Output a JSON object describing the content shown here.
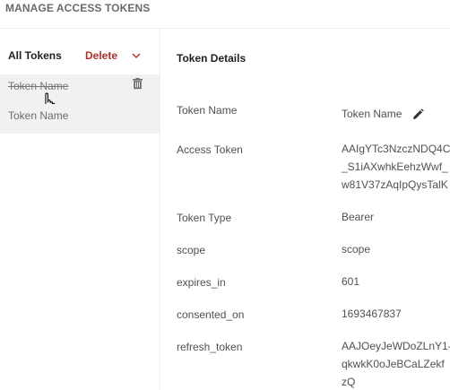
{
  "header": {
    "title": "MANAGE ACCESS TOKENS"
  },
  "sidebar": {
    "all_tokens_label": "All Tokens",
    "delete_label": "Delete",
    "tokens": [
      {
        "label": "Token Name",
        "selected": true
      },
      {
        "label": "Token Name",
        "selected": false
      }
    ]
  },
  "details": {
    "title": "Token Details",
    "fields": {
      "token_name": {
        "label": "Token Name",
        "value": "Token Name"
      },
      "access_token": {
        "label": "Access Token",
        "lines": [
          "AAIgYTc3NzczNDQ4C",
          "_S1iAXwhkEehzWwf_",
          "w81V37zAqIpQysTalK"
        ]
      },
      "token_type": {
        "label": "Token Type",
        "value": "Bearer"
      },
      "scope": {
        "label": "scope",
        "value": "scope"
      },
      "expires_in": {
        "label": "expires_in",
        "value": "601"
      },
      "consented_on": {
        "label": "consented_on",
        "value": "1693467837"
      },
      "refresh_token": {
        "label": "refresh_token",
        "lines": [
          "AAJOeyJeWDoZLnY1-",
          "qkwkK0oJeBCaLZekf",
          "zQ"
        ]
      }
    }
  },
  "colors": {
    "delete": "#b0322a",
    "selected_row": "#f1f1f1",
    "text_muted": "#505050"
  },
  "icons": [
    "chevron-down-icon",
    "trash-icon",
    "hand-cursor-icon",
    "pencil-icon"
  ]
}
